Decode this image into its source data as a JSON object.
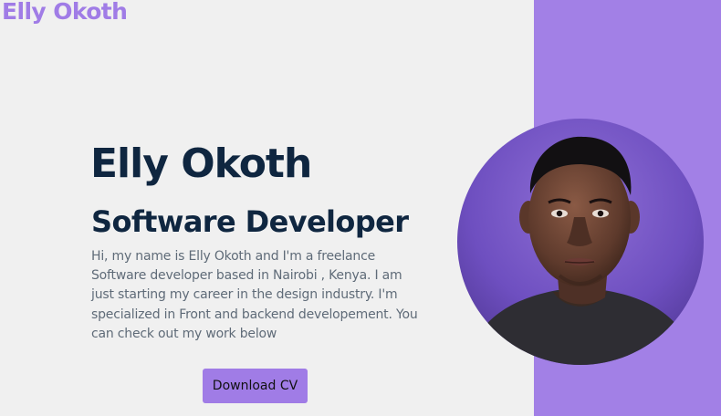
{
  "header": {
    "brand": "Elly Okoth"
  },
  "hero": {
    "name": "Elly Okoth",
    "role": "Software Developer",
    "bio": "Hi, my name is Elly Okoth and I'm a freelance Software developer based in Nairobi , Kenya. I am just starting my career in the design industry. I'm specialized in Front and backend developement. You can check out my work below",
    "download_label": "Download CV"
  },
  "colors": {
    "accent": "#a280e6",
    "heading": "#0f2640",
    "background": "#f0f0f0"
  }
}
